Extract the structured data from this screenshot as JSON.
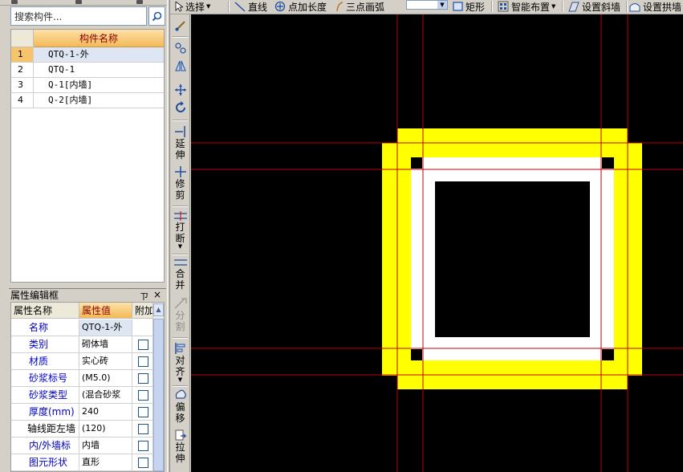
{
  "search": {
    "placeholder": "搜索构件..."
  },
  "component_list": {
    "header": "构件名称",
    "rows": [
      {
        "num": "1",
        "name": "QTQ-1-外"
      },
      {
        "num": "2",
        "name": "QTQ-1"
      },
      {
        "num": "3",
        "name": "Q-1[内墙]"
      },
      {
        "num": "4",
        "name": "Q-2[内墙]"
      }
    ]
  },
  "property_panel": {
    "title": "属性编辑框",
    "pin": "ㄗ",
    "close": "×",
    "headers": {
      "name": "属性名称",
      "value": "属性值",
      "extra": "附加"
    },
    "rows": [
      {
        "name": "名称",
        "value": "QTQ-1-外"
      },
      {
        "name": "类别",
        "value": "砌体墙"
      },
      {
        "name": "材质",
        "value": "实心砖"
      },
      {
        "name": "砂浆标号",
        "value": "(M5.0)"
      },
      {
        "name": "砂浆类型",
        "value": "(混合砂浆"
      },
      {
        "name": "厚度(mm)",
        "value": "240"
      },
      {
        "name": "轴线距左墙",
        "value": "(120)"
      },
      {
        "name": "内/外墙标",
        "value": "内墙"
      },
      {
        "name": "图元形状",
        "value": "直形"
      }
    ]
  },
  "top_toolbar": {
    "select": "选择",
    "line": "直线",
    "point_length": "点加长度",
    "arc": "三点画弧",
    "rect": "矩形",
    "smart": "智能布置",
    "slope": "设置斜墙",
    "arch": "设置拱墙"
  },
  "vertical_toolbar": {
    "extend": [
      "延",
      "伸"
    ],
    "trim": [
      "修",
      "剪"
    ],
    "break": [
      "打",
      "断"
    ],
    "merge": [
      "合",
      "并"
    ],
    "split": [
      "分",
      "割"
    ],
    "align": [
      "对",
      "齐"
    ],
    "offset": [
      "偏",
      "移"
    ],
    "stretch": [
      "拉",
      "伸"
    ]
  },
  "colors": {
    "canvas_bg": "#000000",
    "wall_yellow": "#ffff00",
    "wall_white": "#ffffff",
    "axis_red": "#c00000",
    "header_orange": "#f3b958",
    "selection_blue": "#dde6f2"
  }
}
